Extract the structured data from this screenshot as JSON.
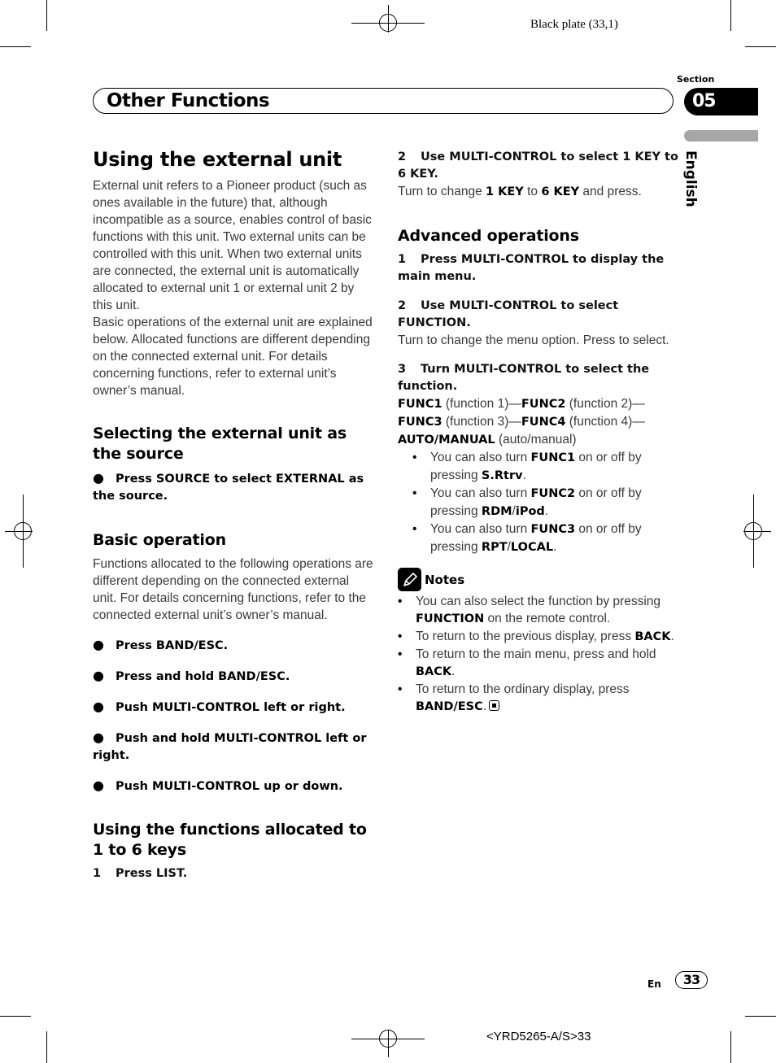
{
  "print_marks": {
    "plate": "Black plate (33,1)",
    "doc_id": "<YRD5265-A/S>33"
  },
  "header": {
    "chapter_title": "Other Functions",
    "section_label": "Section",
    "section_number": "05",
    "language": "English"
  },
  "left_column": {
    "title": "Using the external unit",
    "intro_paragraphs": [
      "External unit refers to a Pioneer product (such as ones available in the future) that, although incompatible as a source, enables control of basic functions with this unit. Two external units can be controlled with this unit. When two external units are connected, the external unit is automatically allocated to external unit 1 or external unit 2 by this unit.",
      "Basic operations of the external unit are explained below. Allocated functions are different depending on the connected external unit. For details concerning functions, refer to external unit’s owner’s manual."
    ],
    "selecting": {
      "heading": "Selecting the external unit as the source",
      "bullet": "●",
      "step": "Press SOURCE to select EXTERNAL as the source."
    },
    "basic": {
      "heading": "Basic operation",
      "text": "Functions allocated to the following operations are different depending on the connected external unit. For details concerning functions, refer to the connected external unit’s owner’s manual.",
      "bullet": "●",
      "steps": [
        "Press BAND/ESC.",
        "Press and hold BAND/ESC.",
        "Push MULTI-CONTROL left or right.",
        "Push and hold MULTI-CONTROL left or right.",
        "Push MULTI-CONTROL up or down."
      ]
    },
    "keys": {
      "heading": "Using the functions allocated to 1 to 6 keys",
      "step1_num": "1",
      "step1": "Press LIST."
    }
  },
  "right_column": {
    "keys_step2": {
      "num": "2",
      "title": "Use MULTI-CONTROL to select 1 KEY to 6 KEY.",
      "text_a": "Turn to change ",
      "bold_a": "1 KEY",
      "text_b": " to ",
      "bold_b": "6 KEY",
      "text_c": " and press."
    },
    "advanced": {
      "heading": "Advanced operations",
      "step1_num": "1",
      "step1": "Press MULTI-CONTROL to display the main menu.",
      "step2_num": "2",
      "step2": "Use MULTI-CONTROL to select FUNCTION.",
      "step2_text": "Turn to change the menu option. Press to select.",
      "step3_num": "3",
      "step3": "Turn MULTI-CONTROL to select the function.",
      "functions": [
        {
          "key": "FUNC1",
          "desc": " (function 1)—"
        },
        {
          "key": "FUNC2",
          "desc": " (function 2)—"
        },
        {
          "key": "FUNC3",
          "desc": " (function 3)—"
        },
        {
          "key": "FUNC4",
          "desc": " (function 4)—"
        },
        {
          "key": "AUTO/MANUAL",
          "desc": " (auto/manual)"
        }
      ],
      "tips": [
        {
          "pre": "You can also turn ",
          "func": "FUNC1",
          "mid": " on or off by pressing ",
          "btn": "S.Rtrv",
          "btn2": "",
          "post": "."
        },
        {
          "pre": "You can also turn ",
          "func": "FUNC2",
          "mid": " on or off by pressing ",
          "btn": "RDM",
          "btn2": "iPod",
          "post": "."
        },
        {
          "pre": "You can also turn ",
          "func": "FUNC3",
          "mid": " on or off by pressing ",
          "btn": "RPT",
          "btn2": "LOCAL",
          "post": "."
        }
      ]
    },
    "notes": {
      "icon": "pencil-icon",
      "label": "Notes",
      "items": [
        {
          "pre": "You can also select the function by pressing ",
          "bold": "FUNCTION",
          "post": " on the remote control."
        },
        {
          "pre": "To return to the previous display, press ",
          "bold": "BACK",
          "post": "."
        },
        {
          "pre": "To return to the main menu, press and hold ",
          "bold": "BACK",
          "post": "."
        },
        {
          "pre": "To return to the ordinary display, press ",
          "bold": "BAND/ESC",
          "post": "."
        }
      ]
    }
  },
  "footer": {
    "lang_code": "En",
    "page_number": "33"
  }
}
